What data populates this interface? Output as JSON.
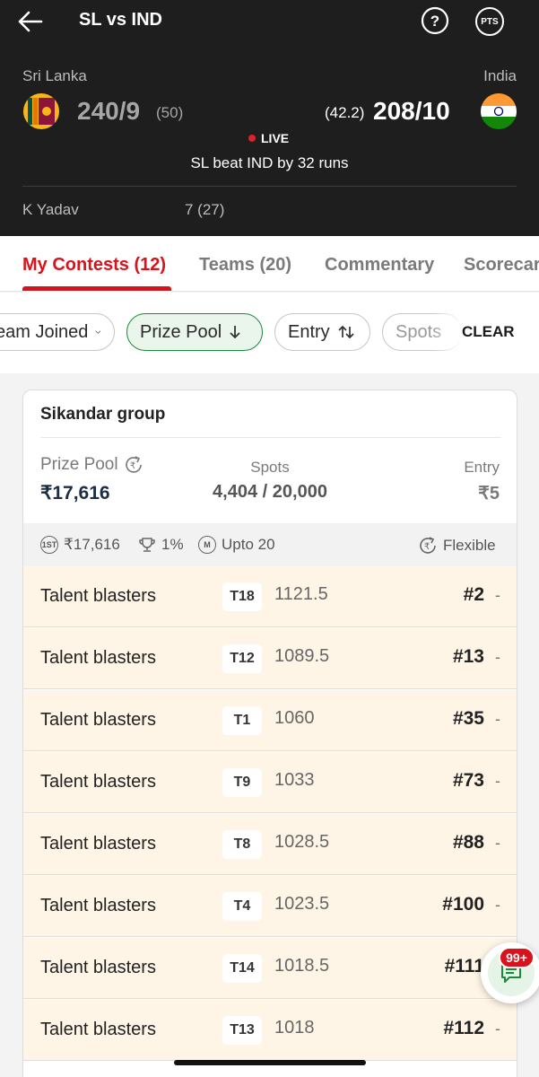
{
  "header": {
    "title": "SL vs IND",
    "pts_label": "PTS",
    "team_left": {
      "name": "Sri Lanka",
      "score": "240/9",
      "overs": "(50)"
    },
    "team_right": {
      "name": "India",
      "score": "208/10",
      "overs": "(42.2)"
    },
    "live_label": "LIVE",
    "result": "SL beat IND by 32 runs",
    "bowler": {
      "name": "K Yadav",
      "figures": "7 (27)"
    }
  },
  "tabs": [
    {
      "label": "My Contests (12)",
      "active": true
    },
    {
      "label": "Teams (20)"
    },
    {
      "label": "Commentary"
    },
    {
      "label": "Scorecard"
    }
  ],
  "filters": {
    "chips": [
      "Team Joined",
      "Prize Pool",
      "Entry",
      "Spots"
    ],
    "clear_label": "CLEAR"
  },
  "contest": {
    "name": "Sikandar group",
    "prize_pool_label": "Prize Pool",
    "prize_pool": "₹17,616",
    "spots_label": "Spots",
    "spots": "4,404 / 20,000",
    "entry_label": "Entry",
    "entry": "₹5",
    "first_prize": "₹17,616",
    "winners_pct": "1%",
    "max_teams": "Upto 20",
    "type": "Flexible",
    "first_badge": "1ST",
    "m_badge": "M"
  },
  "teams": [
    {
      "name": "Talent blasters",
      "tag": "T18",
      "points": "1121.5",
      "rank": "#2",
      "change": "-"
    },
    {
      "name": "Talent blasters",
      "tag": "T12",
      "points": "1089.5",
      "rank": "#13",
      "change": "-"
    },
    {
      "name": "Talent blasters",
      "tag": "T1",
      "points": "1060",
      "rank": "#35",
      "change": "-"
    },
    {
      "name": "Talent blasters",
      "tag": "T9",
      "points": "1033",
      "rank": "#73",
      "change": "-"
    },
    {
      "name": "Talent blasters",
      "tag": "T8",
      "points": "1028.5",
      "rank": "#88",
      "change": "-"
    },
    {
      "name": "Talent blasters",
      "tag": "T4",
      "points": "1023.5",
      "rank": "#100",
      "change": "-"
    },
    {
      "name": "Talent blasters",
      "tag": "T14",
      "points": "1018.5",
      "rank": "#111",
      "change": "-"
    },
    {
      "name": "Talent blasters",
      "tag": "T13",
      "points": "1018",
      "rank": "#112",
      "change": "-"
    }
  ],
  "chat": {
    "badge": "99+"
  },
  "colors": {
    "accent": "#d9131c",
    "header_bg": "#1e1e1e",
    "row_bg": "#fff5e6",
    "chip_active": "#1c8a3c"
  }
}
